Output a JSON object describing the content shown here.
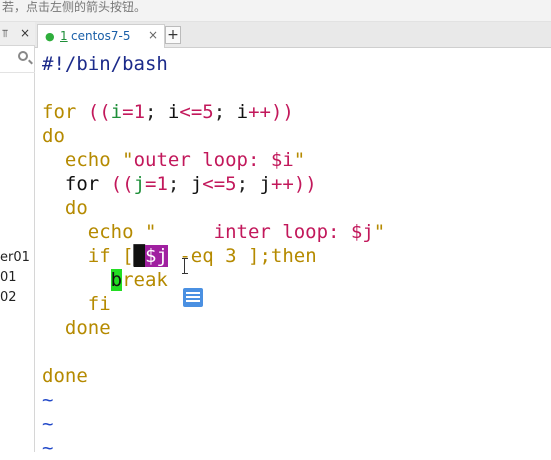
{
  "hint_text": "若，点击左侧的箭头按钮。",
  "left_panel": {
    "pin_icon": "pin-icon",
    "close_label": "×",
    "session_items": [
      "er01",
      "01",
      "02"
    ]
  },
  "tab": {
    "number": "1",
    "title": "centos7-5",
    "close_label": "×",
    "status_color": "#2fae3c"
  },
  "add_tab_label": "+",
  "editor": {
    "lines": [
      "#!/bin/bash",
      "",
      "for ((i=1; i<=5; i++))",
      "do",
      "  echo \"outer loop: $i\"",
      "  for ((j=1; j<=5; j++))",
      "  do",
      "    echo \"     inter loop: $j\"",
      "    if [ $j -eq 3 ];then",
      "      break",
      "    fi",
      "  done",
      "",
      "done",
      "~",
      "~",
      "~"
    ]
  },
  "colors": {
    "keyword": "#b58a00",
    "operator": "#c2185b",
    "number": "#1e8f39",
    "tilde": "#2148c8",
    "selection": "#a020a0",
    "match_highlight": "#22dd22"
  }
}
